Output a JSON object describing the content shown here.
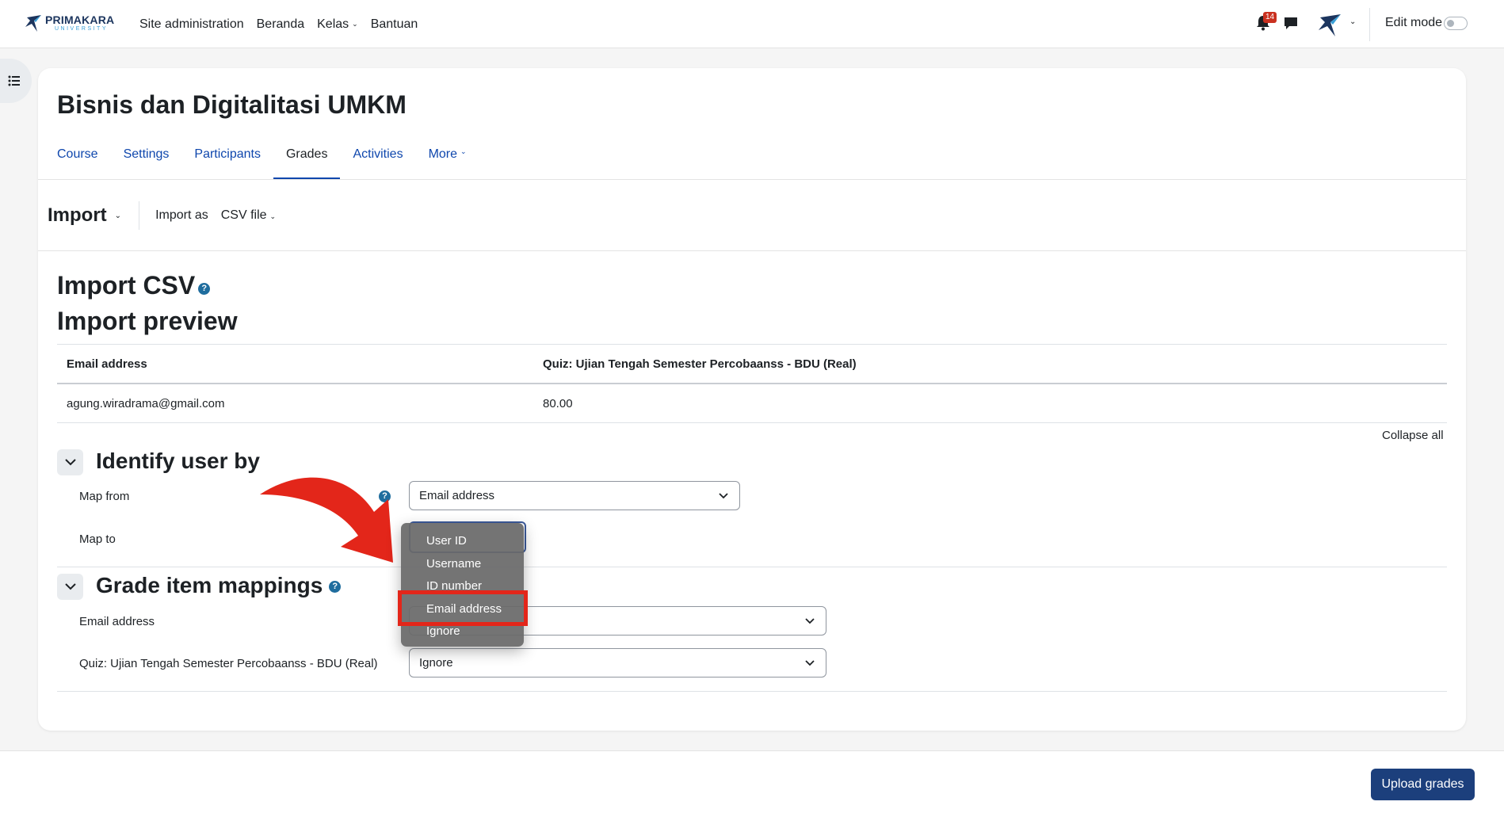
{
  "brand": {
    "name": "PRIMAKARA",
    "sub": "UNIVERSITY"
  },
  "nav": {
    "site_admin": "Site administration",
    "beranda": "Beranda",
    "kelas": "Kelas",
    "bantuan": "Bantuan",
    "notification_count": "14",
    "edit_mode": "Edit mode"
  },
  "course": {
    "title": "Bisnis dan Digitalitasi UMKM",
    "tabs": [
      "Course",
      "Settings",
      "Participants",
      "Grades",
      "Activities",
      "More"
    ],
    "active_tab": "Grades"
  },
  "import_bar": {
    "title": "Import",
    "import_as_label": "Import as",
    "import_as_value": "CSV file"
  },
  "headings": {
    "import_csv": "Import CSV",
    "import_preview": "Import preview"
  },
  "preview_table": {
    "headers": [
      "Email address",
      "Quiz: Ujian Tengah Semester Percobaanss - BDU (Real)"
    ],
    "rows": [
      [
        "agung.wiradrama@gmail.com",
        "80.00"
      ]
    ]
  },
  "collapse_all": "Collapse all",
  "identify": {
    "title": "Identify user by",
    "map_from_label": "Map from",
    "map_from_value": "Email address",
    "map_to_label": "Map to"
  },
  "mappings": {
    "title": "Grade item mappings",
    "rows": [
      {
        "label": "Email address",
        "value": ""
      },
      {
        "label": "Quiz: Ujian Tengah Semester Percobaanss - BDU (Real)",
        "value": "Ignore"
      }
    ]
  },
  "dropdown": {
    "options": [
      "User ID",
      "Username",
      "ID number",
      "Email address",
      "Ignore"
    ],
    "highlighted": "Email address"
  },
  "footer": {
    "upload_button": "Upload grades"
  },
  "colors": {
    "primary": "#0f47ad",
    "button": "#1c3f7c",
    "badge": "#ca3120",
    "highlight": "#e3261a"
  }
}
